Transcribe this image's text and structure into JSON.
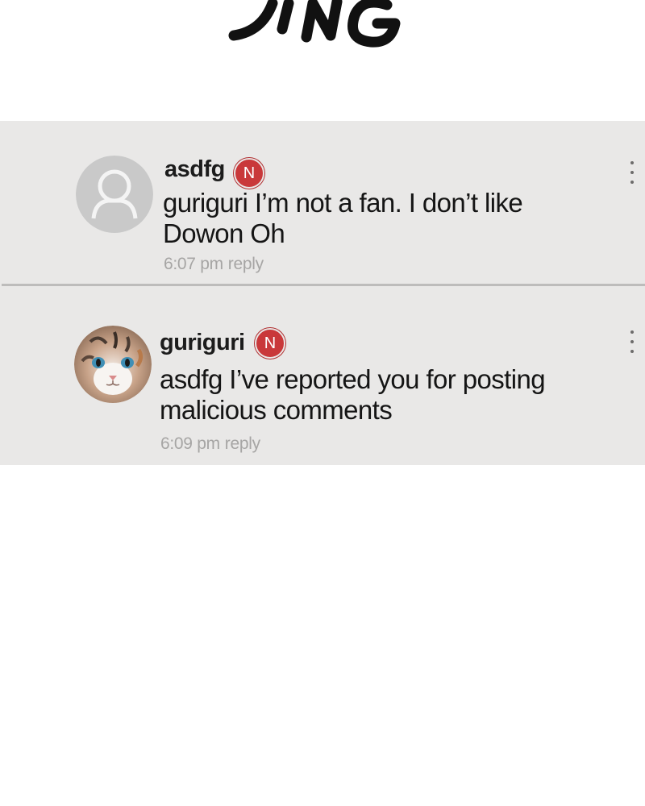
{
  "sfx": {
    "text": "DING"
  },
  "comments": [
    {
      "username": "asdfg",
      "badge": "N",
      "text": "guriguri I’m not a fan. I don’t like Dowon Oh",
      "time": "6:07 pm",
      "reply_label": "reply",
      "avatar": "default-user-avatar"
    },
    {
      "username": "guriguri",
      "badge": "N",
      "text": "asdfg I’ve reported you for posting malicious comments",
      "time": "6:09 pm",
      "reply_label": "reply",
      "avatar": "cat-photo-avatar"
    }
  ],
  "colors": {
    "panel_bg": "#e9e8e7",
    "badge_red": "#c9383a",
    "meta_gray": "#a6a5a4"
  }
}
